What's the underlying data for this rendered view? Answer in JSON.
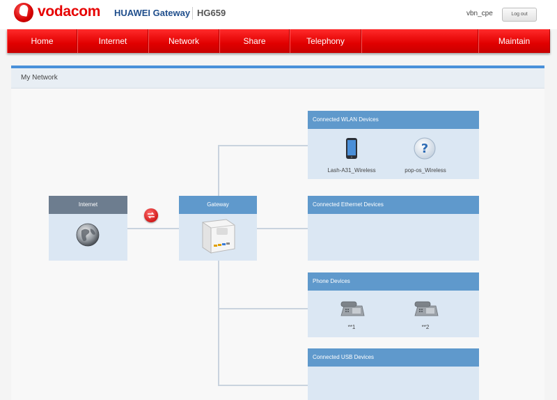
{
  "header": {
    "brand": "vodacom",
    "product": "HUAWEI Gateway",
    "model": "HG659",
    "username": "vbn_cpe",
    "logout_label": "Log out"
  },
  "nav": {
    "items": [
      "Home",
      "Internet",
      "Network",
      "Share",
      "Telephony",
      "",
      "Maintain"
    ]
  },
  "panel": {
    "title": "My Network"
  },
  "topology": {
    "internet_label": "Internet",
    "gateway_label": "Gateway",
    "wlan": {
      "title": "Connected WLAN Devices",
      "devices": [
        "Lash-A31_Wireless",
        "pop-os_Wireless"
      ]
    },
    "ethernet": {
      "title": "Connected Ethernet Devices"
    },
    "phone": {
      "title": "Phone Devices",
      "devices": [
        "**1",
        "**2"
      ]
    },
    "usb": {
      "title": "Connected USB Devices"
    }
  },
  "colors": {
    "accent_red": "#e60000",
    "box_header_blue": "#5f99cc",
    "box_body": "#dbe7f3",
    "internet_header": "#6d7d8f"
  }
}
